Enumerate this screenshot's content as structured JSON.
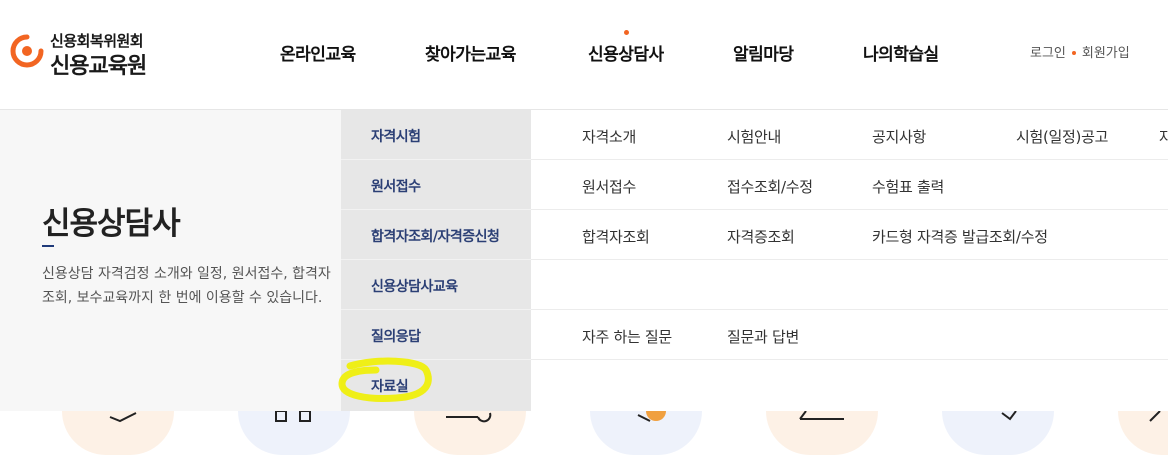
{
  "logo": {
    "top_text": "신용회복위원회",
    "bottom_text": "신용교육원",
    "mark_color": "#f26522"
  },
  "gnb": {
    "items": [
      "온라인교육",
      "찾아가는교육",
      "신용상담사",
      "알림마당",
      "나의학습실"
    ],
    "active_index": 2
  },
  "util": {
    "login": "로그인",
    "join": "회원가입"
  },
  "mega": {
    "title": "신용상담사",
    "description": "신용상담 자격검정 소개와 일정, 원서접수, 합격자조회, 보수교육까지 한 번에 이용할 수 있습니다.",
    "categories": [
      {
        "label": "자격시험",
        "subs": [
          "자격소개",
          "시험안내",
          "공지사항",
          "시험(일정)공고",
          "자"
        ]
      },
      {
        "label": "원서접수",
        "subs": [
          "원서접수",
          "접수조회/수정",
          "수험표 출력"
        ]
      },
      {
        "label": "합격자조회/자격증신청",
        "subs": [
          "합격자조회",
          "자격증조회",
          "카드형 자격증 발급조회/수정"
        ]
      },
      {
        "label": "신용상담사교육",
        "subs": []
      },
      {
        "label": "질의응답",
        "subs": [
          "자주 하는 질문",
          "질문과 답변"
        ]
      },
      {
        "label": "자료실",
        "subs": []
      }
    ]
  },
  "colors": {
    "accent": "#f26522",
    "category_text": "#2b3f75",
    "highlight": "#f0f000"
  }
}
